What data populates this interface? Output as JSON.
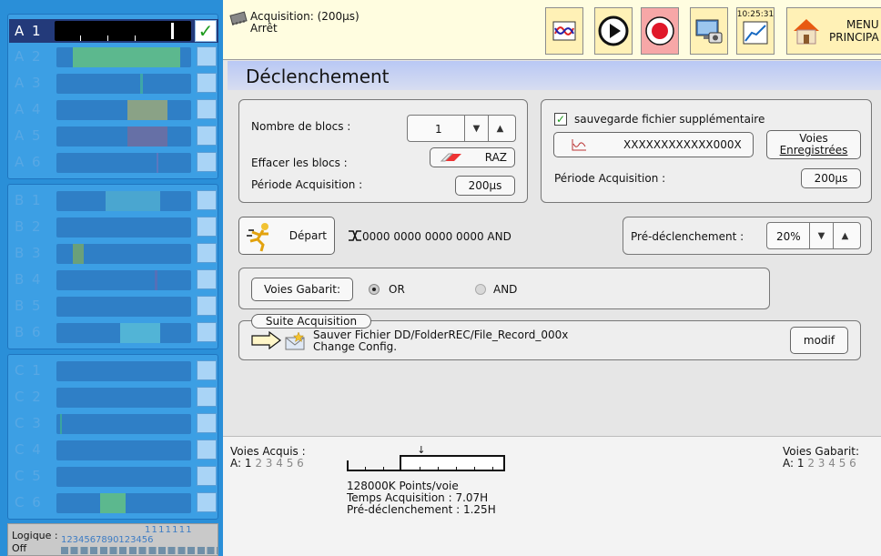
{
  "channels": {
    "group_a": [
      {
        "label": "A 1",
        "active": true,
        "checked": true
      },
      {
        "label": "A 2",
        "active": false,
        "checked": false
      },
      {
        "label": "A 3",
        "active": false,
        "checked": false
      },
      {
        "label": "A 4",
        "active": false,
        "checked": false
      },
      {
        "label": "A 5",
        "active": false,
        "checked": false
      },
      {
        "label": "A 6",
        "active": false,
        "checked": false
      }
    ],
    "group_b": [
      {
        "label": "B 1"
      },
      {
        "label": "B 2"
      },
      {
        "label": "B 3"
      },
      {
        "label": "B 4"
      },
      {
        "label": "B 5"
      },
      {
        "label": "B 6"
      }
    ],
    "group_c": [
      {
        "label": "C 1"
      },
      {
        "label": "C 2"
      },
      {
        "label": "C 3"
      },
      {
        "label": "C 4"
      },
      {
        "label": "C 5"
      },
      {
        "label": "C 6"
      }
    ],
    "check_glyph": "✓"
  },
  "logique": {
    "label": "Logique :",
    "state": "Off",
    "tens_digits": "1 1 1 1 1 1 1",
    "units_digits": "1 2 3 4 5 6 7 8 9 0 1 2 3 4 5 6"
  },
  "topbar": {
    "acq_line1": "Acquisition: (200µs)",
    "acq_line2": "Arrêt",
    "clock": "10:25:31",
    "menu_line1": "MENU",
    "menu_line2": "PRINCIPA",
    "record_color": "#e0182a",
    "record_bg": "#f7a7a7"
  },
  "main": {
    "title": "Déclenchement",
    "nb_blocs_label": "Nombre de blocs :",
    "nb_blocs_value": "1",
    "effacer_label": "Effacer les blocs :",
    "raz_label": "RAZ",
    "periode_label": "Période Acquisition :",
    "periode_value": "200µs",
    "sauvegarde_label": "sauvegarde fichier supplémentaire",
    "file_name": "XXXXXXXXXXXX000X",
    "voies_enreg_line1": "Voies",
    "voies_enreg_line2": "Enregistrées",
    "periode2_label": "Période Acquisition :",
    "periode2_value": "200µs",
    "depart_label": "Départ",
    "trigger_expr": "0000 0000 0000 0000 AND",
    "predecl_label": "Pré-déclenchement :",
    "predecl_value": "20%",
    "voies_gabarit_button": "Voies Gabarit:",
    "or_label": "OR",
    "and_label": "AND",
    "suite_label": "Suite Acquisition",
    "suite_line1": "Sauver Fichier DD/FolderREC/File_Record_000x",
    "suite_line2": "Change Config.",
    "modif_label": "modif"
  },
  "footer": {
    "voies_acquis_label": "Voies Acquis :",
    "voies_acquis_prefix": "A:",
    "voies_acquis_active": "1",
    "voies_acquis_rest": "2 3 4 5 6",
    "points": "128000K Points/voie",
    "temps": "Temps Acquisition : 7.07H",
    "predecl": "Pré-déclenchement :  1.25H",
    "voies_gabarit_label": "Voies Gabarit:",
    "voies_gabarit_prefix": "A:",
    "voies_gabarit_active": "1",
    "voies_gabarit_rest": "2 3 4 5 6",
    "pretrigger_fraction": 0.2
  }
}
